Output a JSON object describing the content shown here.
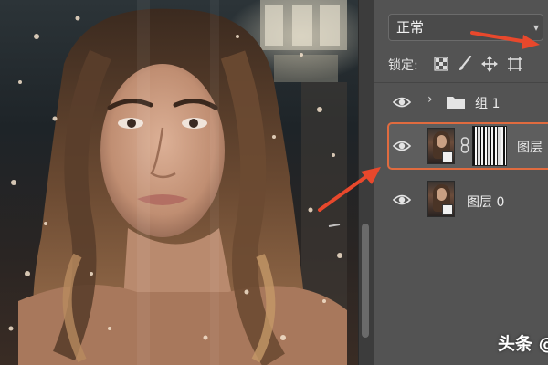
{
  "layers_panel": {
    "blend_mode": {
      "value": "正常"
    },
    "lock": {
      "label": "锁定:",
      "icons": [
        "transparency-lock-icon",
        "brush-lock-icon",
        "move-lock-icon",
        "artboard-lock-icon"
      ]
    },
    "layers": [
      {
        "type": "group",
        "name": "组 1",
        "visible": true,
        "expanded": false
      },
      {
        "type": "layer",
        "name": "图层",
        "visible": true,
        "selected": true,
        "has_mask": true,
        "linked": true
      },
      {
        "type": "layer",
        "name": "图层 0",
        "visible": true,
        "selected": false
      }
    ]
  },
  "canvas": {
    "content": "portrait-photo"
  },
  "annotations": {
    "arrow_color": "#e8482c",
    "selection_color": "#e06b3f"
  },
  "watermark": {
    "text": "头条 @"
  }
}
